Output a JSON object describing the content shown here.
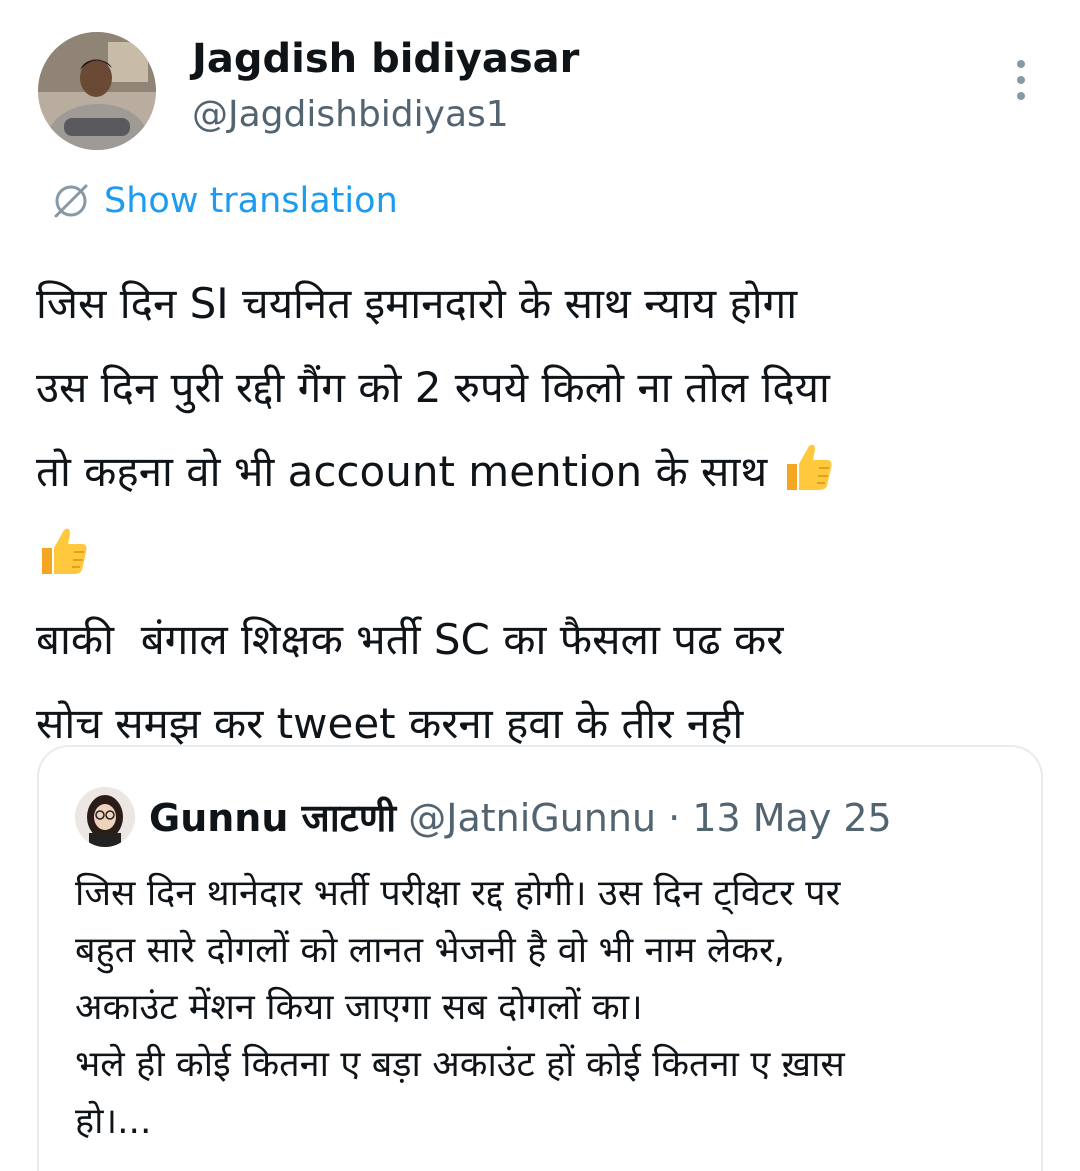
{
  "author": {
    "name": "Jagdish bidiyasar",
    "handle": "@Jagdishbidiyas1"
  },
  "menu_icon": "more-vertical-icon",
  "translation": {
    "label": "Show translation",
    "icon": "globe-icon"
  },
  "tweet": {
    "line1": "जिस दिन SI चयनित इमानदारो के साथ न्याय होगा",
    "line2": "उस दिन पुरी रद्दी गैंग को 2 रुपये किलो ना तोल दिया",
    "line3": "तो कहना वो भी account mention के साथ ",
    "line4": "बाकी  बंगाल शिक्षक भर्ती SC का फैसला पढ कर",
    "line5": "सोच समझ कर tweet करना हवा के तीर नही",
    "emoji": "thumbs-up-icon"
  },
  "quoted": {
    "name": "Gunnu जाटणी",
    "handle": "@JatniGunnu",
    "separator": " · ",
    "date": "13 May 25",
    "line1": "जिस दिन थानेदार भर्ती परीक्षा रद्द होगी। उस दिन ट्विटर पर",
    "line2": "बहुत सारे दोगलों को लानत भेजनी है वो भी नाम लेकर,",
    "line3": "अकाउंट मेंशन किया जाएगा सब दोगलों का।",
    "line4": "भले ही कोई कितना ए बड़ा अकाउंट हों कोई कितना ए ख़ास",
    "line5": "हो।..."
  },
  "colors": {
    "accent": "#1d9bf0",
    "secondary_text": "#536471",
    "primary_text": "#0f1419",
    "border": "#e6ecf0"
  }
}
